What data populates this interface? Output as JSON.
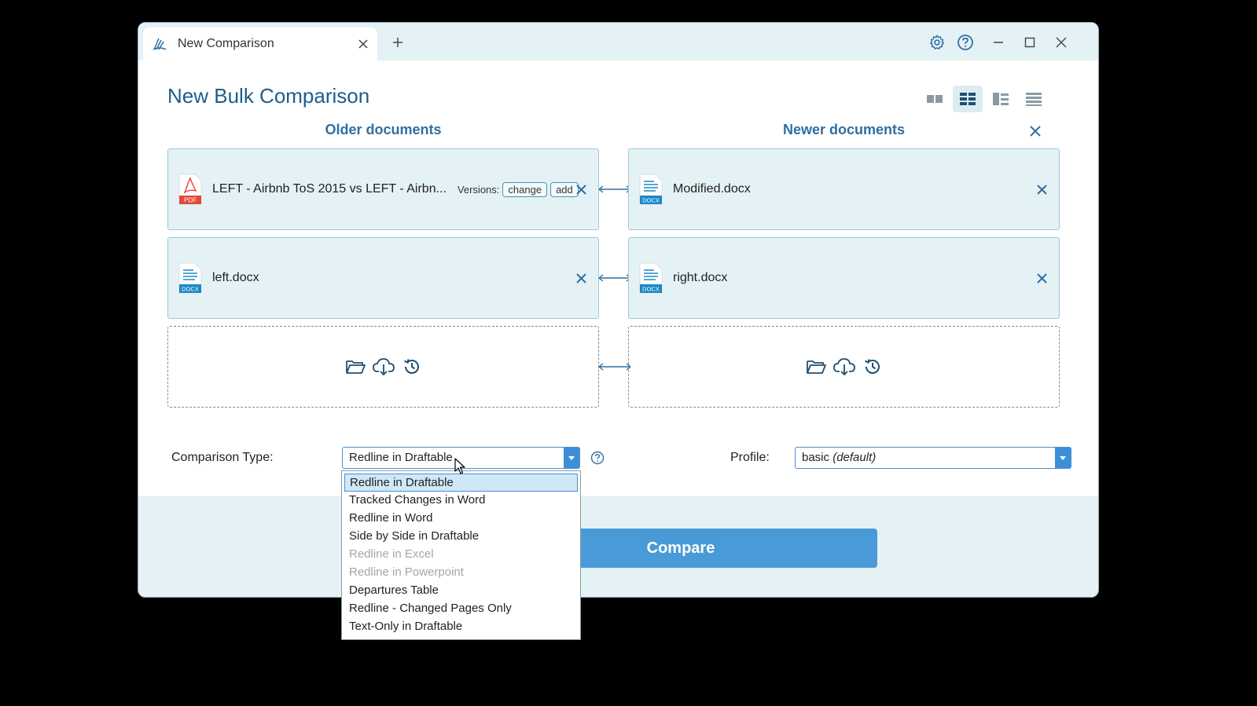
{
  "tab": {
    "label": "New Comparison"
  },
  "page": {
    "title": "New Bulk Comparison"
  },
  "columns": {
    "older": "Older documents",
    "newer": "Newer documents"
  },
  "rows": [
    {
      "left": {
        "name": "LEFT - Airbnb ToS 2015 vs LEFT - Airbn...",
        "type": "PDF",
        "versions_label": "Versions:",
        "change_label": "change",
        "add_label": "add"
      },
      "right": {
        "name": "Modified.docx",
        "type": "DOCX"
      }
    },
    {
      "left": {
        "name": "left.docx",
        "type": "DOCX"
      },
      "right": {
        "name": "right.docx",
        "type": "DOCX"
      }
    }
  ],
  "comparison_type": {
    "label": "Comparison Type:",
    "value": "Redline in Draftable",
    "options": [
      {
        "label": "Redline in Draftable",
        "state": "selected"
      },
      {
        "label": "Tracked Changes in Word",
        "state": "enabled"
      },
      {
        "label": "Redline in Word",
        "state": "enabled"
      },
      {
        "label": "Side by Side in Draftable",
        "state": "enabled"
      },
      {
        "label": "Redline in Excel",
        "state": "disabled"
      },
      {
        "label": "Redline in Powerpoint",
        "state": "disabled"
      },
      {
        "label": "Departures Table",
        "state": "enabled"
      },
      {
        "label": "Redline - Changed Pages Only",
        "state": "enabled"
      },
      {
        "label": "Text-Only in Draftable",
        "state": "enabled"
      }
    ]
  },
  "profile": {
    "label": "Profile:",
    "value": "basic",
    "value_suffix": "(default)"
  },
  "compare_button": "Compare",
  "colors": {
    "accent": "#4a9ad8",
    "title": "#1f5d8c",
    "panel": "#e4f2f5",
    "pdf_red": "#e04a3a",
    "docx_blue": "#1e88c8"
  }
}
